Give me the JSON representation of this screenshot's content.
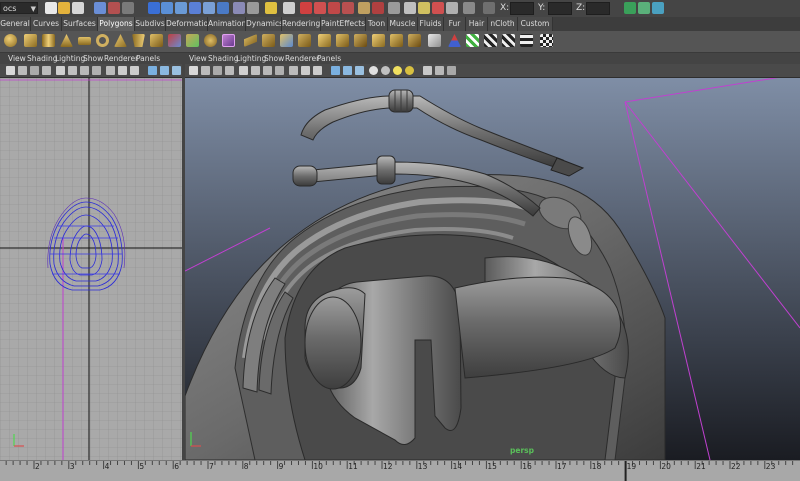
{
  "status_line": {
    "mode_menu": "ocs",
    "xyz_labels": [
      "X:",
      "Y:",
      "Z:"
    ]
  },
  "shelf_tabs": [
    "General",
    "Curves",
    "Surfaces",
    "Polygons",
    "Subdivs",
    "Deformation",
    "Animation",
    "Dynamics",
    "Rendering",
    "PaintEffects",
    "Toon",
    "Muscle",
    "Fluids",
    "Fur",
    "Hair",
    "nCloth",
    "Custom"
  ],
  "active_shelf_tab": "Polygons",
  "panel_menu": [
    "View",
    "Shading",
    "Lighting",
    "Show",
    "Renderer",
    "Panels"
  ],
  "viewports": {
    "left": {
      "camera": ""
    },
    "right": {
      "camera": "persp"
    }
  },
  "timeline": {
    "ticks": [
      "2",
      "3",
      "4",
      "5",
      "6",
      "7",
      "8",
      "9",
      "10",
      "11",
      "12",
      "13",
      "14",
      "15",
      "16",
      "17",
      "18",
      "19",
      "20",
      "21",
      "22",
      "23"
    ],
    "current_frame": "19"
  },
  "colors": {
    "accent": "#d4a84a",
    "grid": "#8f8f8f",
    "wire": "#2a2ad8",
    "camera_frustum": "#c040d0",
    "axis_green": "#4fd84f"
  }
}
